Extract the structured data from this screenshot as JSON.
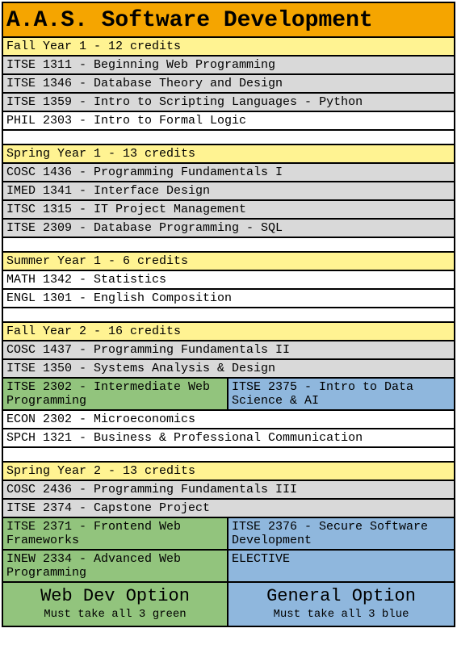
{
  "title": "A.A.S. Software Development",
  "terms": [
    {
      "header": "Fall Year 1 - 12 credits",
      "rows": [
        {
          "type": "single",
          "color": "gray",
          "text": "ITSE 1311 - Beginning Web Programming"
        },
        {
          "type": "single",
          "color": "gray",
          "text": "ITSE 1346 - Database Theory and Design"
        },
        {
          "type": "single",
          "color": "gray",
          "text": "ITSE 1359 - Intro to Scripting Languages - Python"
        },
        {
          "type": "single",
          "color": "white",
          "text": "PHIL 2303 - Intro to Formal Logic"
        }
      ]
    },
    {
      "header": "Spring Year 1 - 13 credits",
      "rows": [
        {
          "type": "single",
          "color": "gray",
          "text": "COSC 1436 - Programming Fundamentals I"
        },
        {
          "type": "single",
          "color": "gray",
          "text": "IMED 1341 - Interface Design"
        },
        {
          "type": "single",
          "color": "gray",
          "text": "ITSC 1315 - IT Project Management"
        },
        {
          "type": "single",
          "color": "gray",
          "text": "ITSE 2309 - Database Programming - SQL"
        }
      ]
    },
    {
      "header": "Summer Year 1 - 6 credits",
      "rows": [
        {
          "type": "single",
          "color": "white",
          "text": "MATH 1342 - Statistics"
        },
        {
          "type": "single",
          "color": "white",
          "text": "ENGL 1301 - English Composition"
        }
      ]
    },
    {
      "header": "Fall Year 2 - 16 credits",
      "rows": [
        {
          "type": "single",
          "color": "gray",
          "text": "COSC 1437 - Programming Fundamentals II"
        },
        {
          "type": "single",
          "color": "gray",
          "text": "ITSE 1350 - Systems Analysis & Design"
        },
        {
          "type": "split",
          "left": {
            "color": "green",
            "text": "ITSE 2302 - Intermediate Web Programming"
          },
          "right": {
            "color": "blue",
            "text": "ITSE 2375 - Intro to Data Science & AI"
          }
        },
        {
          "type": "single",
          "color": "white",
          "text": "ECON 2302 - Microeconomics"
        },
        {
          "type": "single",
          "color": "white",
          "text": "SPCH 1321 - Business & Professional Communication"
        }
      ]
    },
    {
      "header": "Spring Year 2 - 13 credits",
      "rows": [
        {
          "type": "single",
          "color": "gray",
          "text": "COSC 2436 - Programming Fundamentals III"
        },
        {
          "type": "single",
          "color": "gray",
          "text": "ITSE 2374 - Capstone Project"
        },
        {
          "type": "split",
          "left": {
            "color": "green",
            "text": "ITSE 2371 - Frontend Web Frameworks"
          },
          "right": {
            "color": "blue",
            "text": "ITSE 2376 - Secure Software Development"
          }
        },
        {
          "type": "split",
          "left": {
            "color": "green",
            "text": "INEW 2334 - Advanced Web Programming"
          },
          "right": {
            "color": "blue",
            "text": "ELECTIVE"
          }
        }
      ]
    }
  ],
  "options": {
    "left": {
      "title": "Web Dev Option",
      "sub": "Must take all 3 green",
      "color": "green"
    },
    "right": {
      "title": "General Option",
      "sub": "Must take all 3 blue",
      "color": "blue"
    }
  }
}
